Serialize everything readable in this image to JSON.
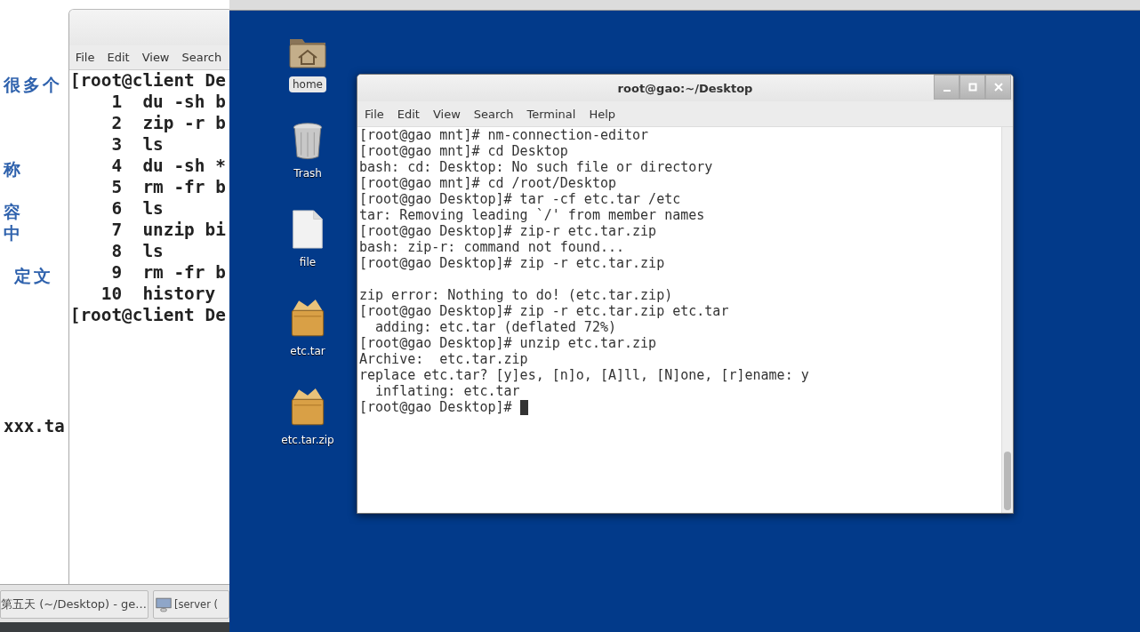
{
  "document": {
    "fragments": [
      {
        "text": "很多个",
        "kind": "heading"
      },
      {
        "text": "称",
        "kind": "heading"
      },
      {
        "text": "容",
        "kind": "heading"
      },
      {
        "text": "中",
        "kind": "heading"
      },
      {
        "text": "定文",
        "kind": "heading"
      },
      {
        "text": "xxx.ta",
        "kind": "code"
      }
    ]
  },
  "left_terminal": {
    "menu": [
      "File",
      "Edit",
      "View",
      "Search"
    ],
    "lines": [
      "[root@client De",
      "    1  du -sh b",
      "    2  zip -r b",
      "    3  ls",
      "    4  du -sh *",
      "    5  rm -fr b",
      "    6  ls",
      "    7  unzip bi",
      "    8  ls",
      "    9  rm -fr b",
      "   10  history",
      "[root@client De"
    ]
  },
  "taskbar": {
    "items": [
      {
        "label": "第五天 (~/Desktop) - ge...",
        "kind": "plain"
      },
      {
        "label": "[server (",
        "kind": "monitor"
      }
    ]
  },
  "desktop": {
    "icons": [
      {
        "label": "home",
        "kind": "home",
        "selected": true
      },
      {
        "label": "Trash",
        "kind": "trash",
        "selected": false
      },
      {
        "label": "file",
        "kind": "file",
        "selected": false
      },
      {
        "label": "etc.tar",
        "kind": "archive",
        "selected": false
      },
      {
        "label": "etc.tar.zip",
        "kind": "archive",
        "selected": false
      }
    ]
  },
  "terminal": {
    "title": "root@gao:~/Desktop",
    "menu": [
      "File",
      "Edit",
      "View",
      "Search",
      "Terminal",
      "Help"
    ],
    "blocks": [
      [
        "[root@gao mnt]# nm-connection-editor",
        "[root@gao mnt]# cd Desktop",
        "bash: cd: Desktop: No such file or directory",
        "[root@gao mnt]# cd /root/Desktop",
        "[root@gao Desktop]# tar -cf etc.tar /etc",
        "tar: Removing leading `/' from member names",
        "[root@gao Desktop]# zip-r etc.tar.zip",
        "bash: zip-r: command not found...",
        "[root@gao Desktop]# zip -r etc.tar.zip"
      ],
      [
        "zip error: Nothing to do! (etc.tar.zip)",
        "[root@gao Desktop]# zip -r etc.tar.zip etc.tar",
        "  adding: etc.tar (deflated 72%)",
        "[root@gao Desktop]# unzip etc.tar.zip",
        "Archive:  etc.tar.zip",
        "replace etc.tar? [y]es, [n]o, [A]ll, [N]one, [r]ename: y",
        "  inflating: etc.tar",
        "[root@gao Desktop]# "
      ]
    ],
    "cursor": true
  }
}
